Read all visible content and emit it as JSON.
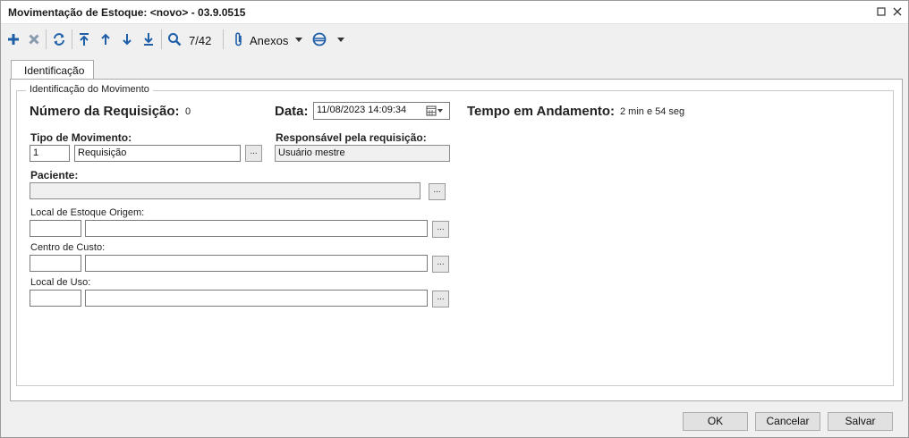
{
  "window": {
    "title": "Movimentação de Estoque: <novo> - 03.9.0515"
  },
  "toolbar": {
    "record_counter": "7/42",
    "attachments_label": "Anexos"
  },
  "tabs": [
    {
      "label": "Identificação"
    }
  ],
  "form": {
    "group_title": "Identificação do Movimento",
    "numero_label": "Número da Requisição:",
    "numero_value": "0",
    "data_label": "Data:",
    "data_value": "11/08/2023 14:09:34",
    "tempo_label": "Tempo em Andamento:",
    "tempo_value": "2 min e 54 seg",
    "tipo_label": "Tipo de Movimento:",
    "tipo_code": "1",
    "tipo_desc": "Requisição",
    "responsavel_label": "Responsável pela requisição:",
    "responsavel_value": "Usuário mestre",
    "paciente_label": "Paciente:",
    "paciente_value": "",
    "local_origem_label": "Local de Estoque Origem:",
    "centro_custo_label": "Centro de Custo:",
    "local_uso_label": "Local de Uso:",
    "lookup_label": "..."
  },
  "footer": {
    "ok_label": "OK",
    "cancel_label": "Cancelar",
    "save_label": "Salvar"
  }
}
